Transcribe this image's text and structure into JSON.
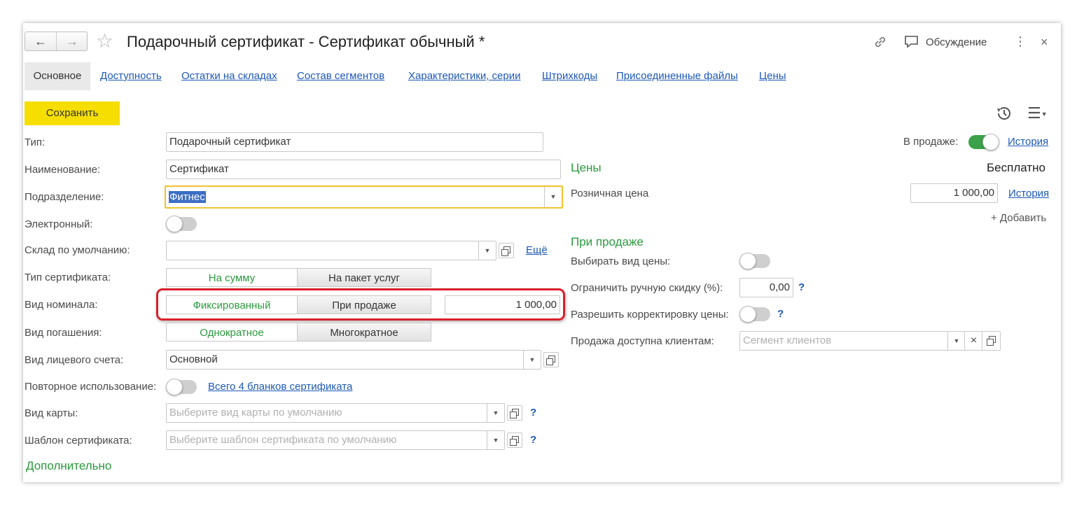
{
  "window": {
    "title": "Подарочный сертификат - Сертификат обычный *",
    "discussion_label": "Обсуждение"
  },
  "tabs": [
    {
      "label": "Основное"
    },
    {
      "label": "Доступность"
    },
    {
      "label": "Остатки на складах"
    },
    {
      "label": "Состав сегментов"
    },
    {
      "label": "Характеристики, серии"
    },
    {
      "label": "Штрихкоды"
    },
    {
      "label": "Присоединенные файлы"
    },
    {
      "label": "Цены"
    }
  ],
  "toolbar": {
    "save_label": "Сохранить"
  },
  "form": {
    "type_label": "Тип:",
    "type_value": "Подарочный сертификат",
    "name_label": "Наименование:",
    "name_value": "Сертификат",
    "division_label": "Подразделение:",
    "division_value": "Фитнес",
    "electronic_label": "Электронный:",
    "warehouse_label": "Склад по умолчанию:",
    "warehouse_more": "Ещё",
    "cert_type_label": "Тип сертификата:",
    "cert_type_options": [
      "На сумму",
      "На пакет услуг"
    ],
    "nominal_label": "Вид номинала:",
    "nominal_options": [
      "Фиксированный",
      "При продаже"
    ],
    "nominal_value": "1 000,00",
    "redemption_label": "Вид погашения:",
    "redemption_options": [
      "Однократное",
      "Многократное"
    ],
    "account_label": "Вид лицевого счета:",
    "account_value": "Основной",
    "reuse_label": "Повторное использование:",
    "reuse_link": "Всего 4 бланков сертификата",
    "card_label": "Вид карты:",
    "card_placeholder": "Выберите вид карты по умолчанию",
    "template_label": "Шаблон сертификата:",
    "template_placeholder": "Выберите шаблон сертификата по умолчанию",
    "additional_label": "Дополнительно"
  },
  "right": {
    "on_sale_label": "В продаже:",
    "history_label": "История",
    "prices_head": "Цены",
    "free_label": "Бесплатно",
    "retail_label": "Розничная цена",
    "retail_value": "1 000,00",
    "retail_history": "История",
    "add_label": "+ Добавить",
    "on_sale_head": "При продаже",
    "choose_price_label": "Выбирать вид цены:",
    "limit_discount_label": "Ограничить ручную скидку (%):",
    "limit_discount_value": "0,00",
    "allow_correction_label": "Разрешить корректировку цены:",
    "clients_label": "Продажа доступна клиентам:",
    "clients_placeholder": "Сегмент клиентов",
    "help_mark": "?"
  },
  "colors": {
    "accent_green": "#2a9a3d",
    "link_blue": "#1c58b7",
    "save_yellow": "#f5de00",
    "highlight_red": "#d9202a"
  }
}
